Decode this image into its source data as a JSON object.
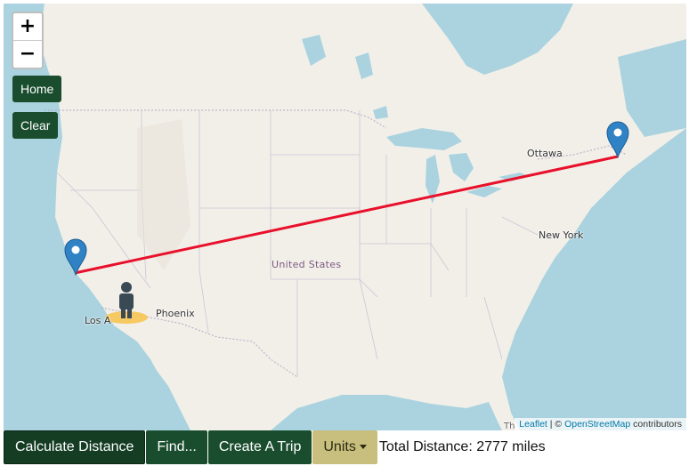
{
  "map": {
    "zoom_in": "+",
    "zoom_out": "−",
    "home_label": "Home",
    "clear_label": "Clear",
    "labels": {
      "ottawa": "Ottawa",
      "new_york": "New York",
      "phoenix": "Phoenix",
      "los_angeles": "Los A",
      "united_states": "United States",
      "edge": "Th"
    },
    "markers": [
      "map-marker-icon",
      "map-marker-icon"
    ],
    "pegman": "pegman-icon",
    "route_color": "#e8102a",
    "marker_color": "#2f82c4",
    "attribution": {
      "leaflet": "Leaflet",
      "sep": "|",
      "copyright": "©",
      "osm": "OpenStreetMap",
      "contributors": "contributors"
    }
  },
  "toolbar": {
    "calculate_label": "Calculate Distance",
    "find_label": "Find...",
    "create_trip_label": "Create A Trip",
    "units_label": "Units",
    "total_distance": "Total Distance: 2777 miles"
  }
}
